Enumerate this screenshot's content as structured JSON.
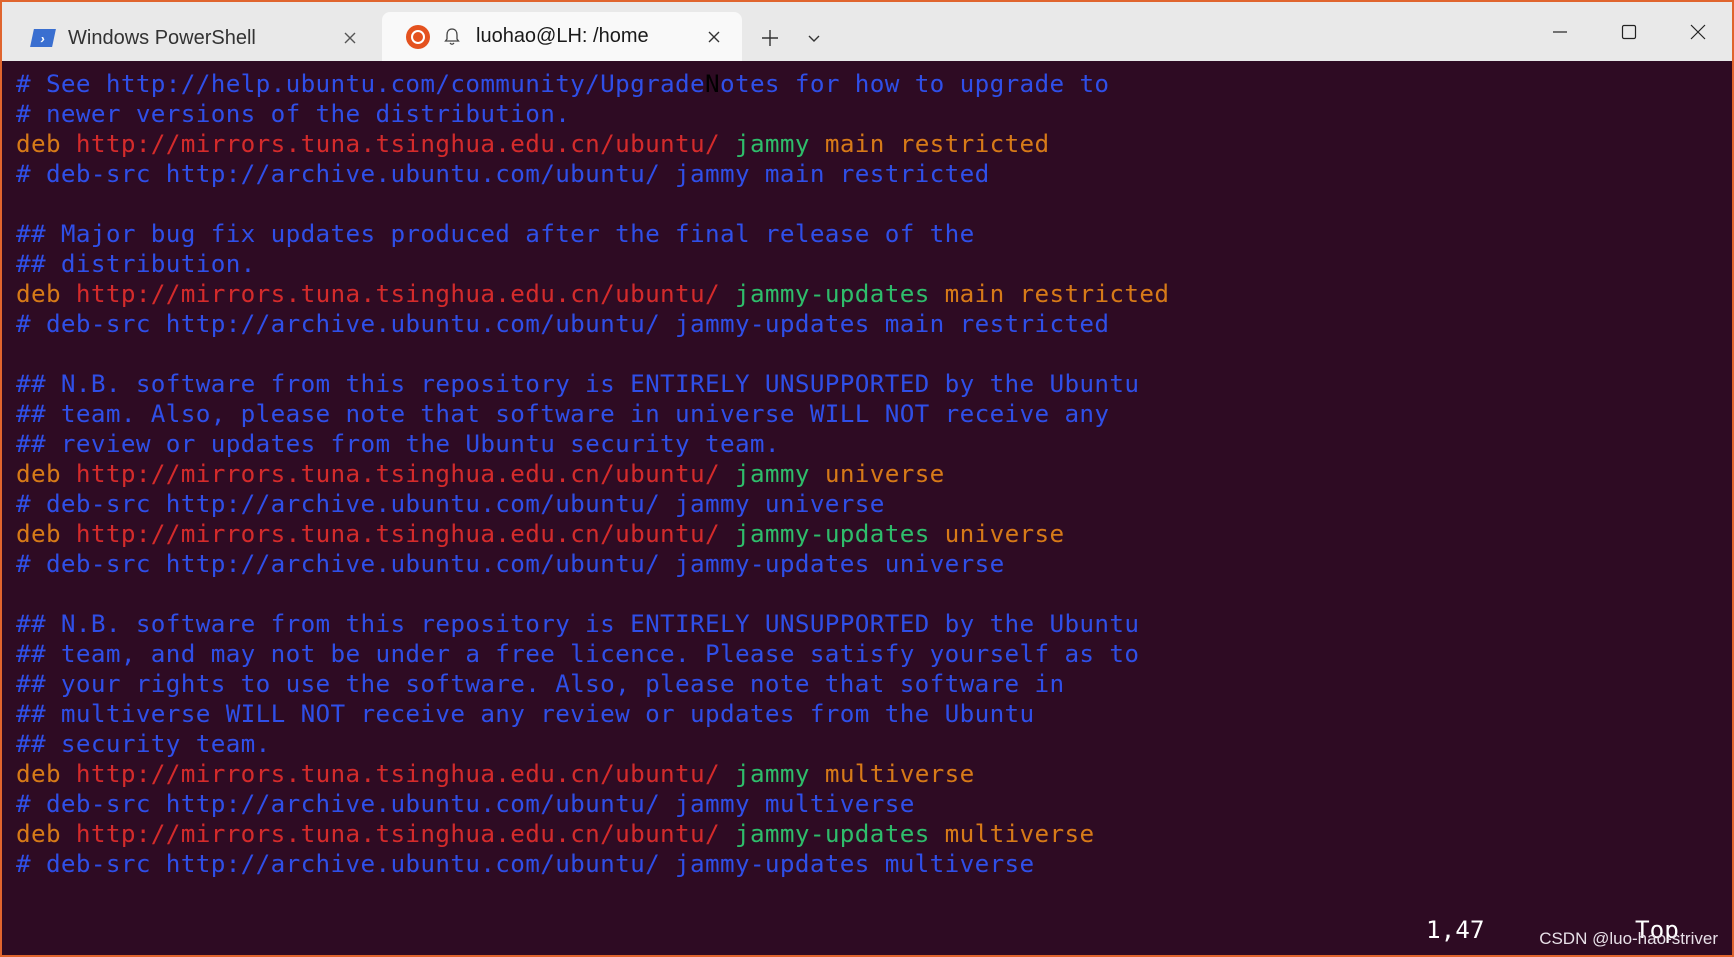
{
  "tabs": [
    {
      "label": "Windows PowerShell",
      "icon": "powershell-icon",
      "active": false
    },
    {
      "label": "luohao@LH: /home",
      "icon": "ubuntu-icon",
      "active": true
    }
  ],
  "tab_actions": {
    "new_tab": "+",
    "dropdown": "⌄"
  },
  "window_controls": {
    "minimize": "—",
    "maximize": "☐",
    "close": "✕"
  },
  "terminal": {
    "lines": [
      [
        {
          "t": "# See http://help.ubuntu.com/community/Upgrade",
          "c": "comment"
        },
        {
          "t": "N",
          "c": "cursor"
        },
        {
          "t": "otes for how to upgrade to",
          "c": "comment"
        }
      ],
      [
        {
          "t": "# newer versions of the distribution.",
          "c": "comment"
        }
      ],
      [
        {
          "t": "deb ",
          "c": "deb"
        },
        {
          "t": "http://mirrors.tuna.tsinghua.edu.cn/ubuntu/",
          "c": "url"
        },
        {
          "t": " jammy",
          "c": "dist"
        },
        {
          "t": " main restricted",
          "c": "comp"
        }
      ],
      [
        {
          "t": "# deb-src http://archive.ubuntu.com/ubuntu/ jammy main restricted",
          "c": "comment"
        }
      ],
      [],
      [
        {
          "t": "## Major bug fix updates produced after the final release of the",
          "c": "comment"
        }
      ],
      [
        {
          "t": "## distribution.",
          "c": "comment"
        }
      ],
      [
        {
          "t": "deb ",
          "c": "deb"
        },
        {
          "t": "http://mirrors.tuna.tsinghua.edu.cn/ubuntu/",
          "c": "url"
        },
        {
          "t": " jammy-updates",
          "c": "dist"
        },
        {
          "t": " main restricted",
          "c": "comp"
        }
      ],
      [
        {
          "t": "# deb-src http://archive.ubuntu.com/ubuntu/ jammy-updates main restricted",
          "c": "comment"
        }
      ],
      [],
      [
        {
          "t": "## N.B. software from this repository is ENTIRELY UNSUPPORTED by the Ubuntu",
          "c": "comment"
        }
      ],
      [
        {
          "t": "## team. Also, please note that software in universe WILL NOT receive any",
          "c": "comment"
        }
      ],
      [
        {
          "t": "## review or updates from the Ubuntu security team.",
          "c": "comment"
        }
      ],
      [
        {
          "t": "deb ",
          "c": "deb"
        },
        {
          "t": "http://mirrors.tuna.tsinghua.edu.cn/ubuntu/",
          "c": "url"
        },
        {
          "t": " jammy",
          "c": "dist"
        },
        {
          "t": " universe",
          "c": "comp"
        }
      ],
      [
        {
          "t": "# deb-src http://archive.ubuntu.com/ubuntu/ jammy universe",
          "c": "comment"
        }
      ],
      [
        {
          "t": "deb ",
          "c": "deb"
        },
        {
          "t": "http://mirrors.tuna.tsinghua.edu.cn/ubuntu/",
          "c": "url"
        },
        {
          "t": " jammy-updates",
          "c": "dist"
        },
        {
          "t": " universe",
          "c": "comp"
        }
      ],
      [
        {
          "t": "# deb-src http://archive.ubuntu.com/ubuntu/ jammy-updates universe",
          "c": "comment"
        }
      ],
      [],
      [
        {
          "t": "## N.B. software from this repository is ENTIRELY UNSUPPORTED by the Ubuntu",
          "c": "comment"
        }
      ],
      [
        {
          "t": "## team, and may not be under a free licence. Please satisfy yourself as to",
          "c": "comment"
        }
      ],
      [
        {
          "t": "## your rights to use the software. Also, please note that software in",
          "c": "comment"
        }
      ],
      [
        {
          "t": "## multiverse WILL NOT receive any review or updates from the Ubuntu",
          "c": "comment"
        }
      ],
      [
        {
          "t": "## security team.",
          "c": "comment"
        }
      ],
      [
        {
          "t": "deb ",
          "c": "deb"
        },
        {
          "t": "http://mirrors.tuna.tsinghua.edu.cn/ubuntu/",
          "c": "url"
        },
        {
          "t": " jammy",
          "c": "dist"
        },
        {
          "t": " multiverse",
          "c": "comp"
        }
      ],
      [
        {
          "t": "# deb-src http://archive.ubuntu.com/ubuntu/ jammy multiverse",
          "c": "comment"
        }
      ],
      [
        {
          "t": "deb ",
          "c": "deb"
        },
        {
          "t": "http://mirrors.tuna.tsinghua.edu.cn/ubuntu/",
          "c": "url"
        },
        {
          "t": " jammy-updates",
          "c": "dist"
        },
        {
          "t": " multiverse",
          "c": "comp"
        }
      ],
      [
        {
          "t": "# deb-src http://archive.ubuntu.com/ubuntu/ jammy-updates multiverse",
          "c": "comment"
        }
      ]
    ],
    "status": {
      "position": "1,47",
      "scroll": "Top"
    }
  },
  "watermark": "CSDN @luo-hao-striver",
  "colors": {
    "comment": "#2f4fe8",
    "deb": "#d77a18",
    "url": "#d42b2b",
    "dist": "#2ebd6b",
    "background": "#2e0b23",
    "window_border": "#e0652e"
  }
}
